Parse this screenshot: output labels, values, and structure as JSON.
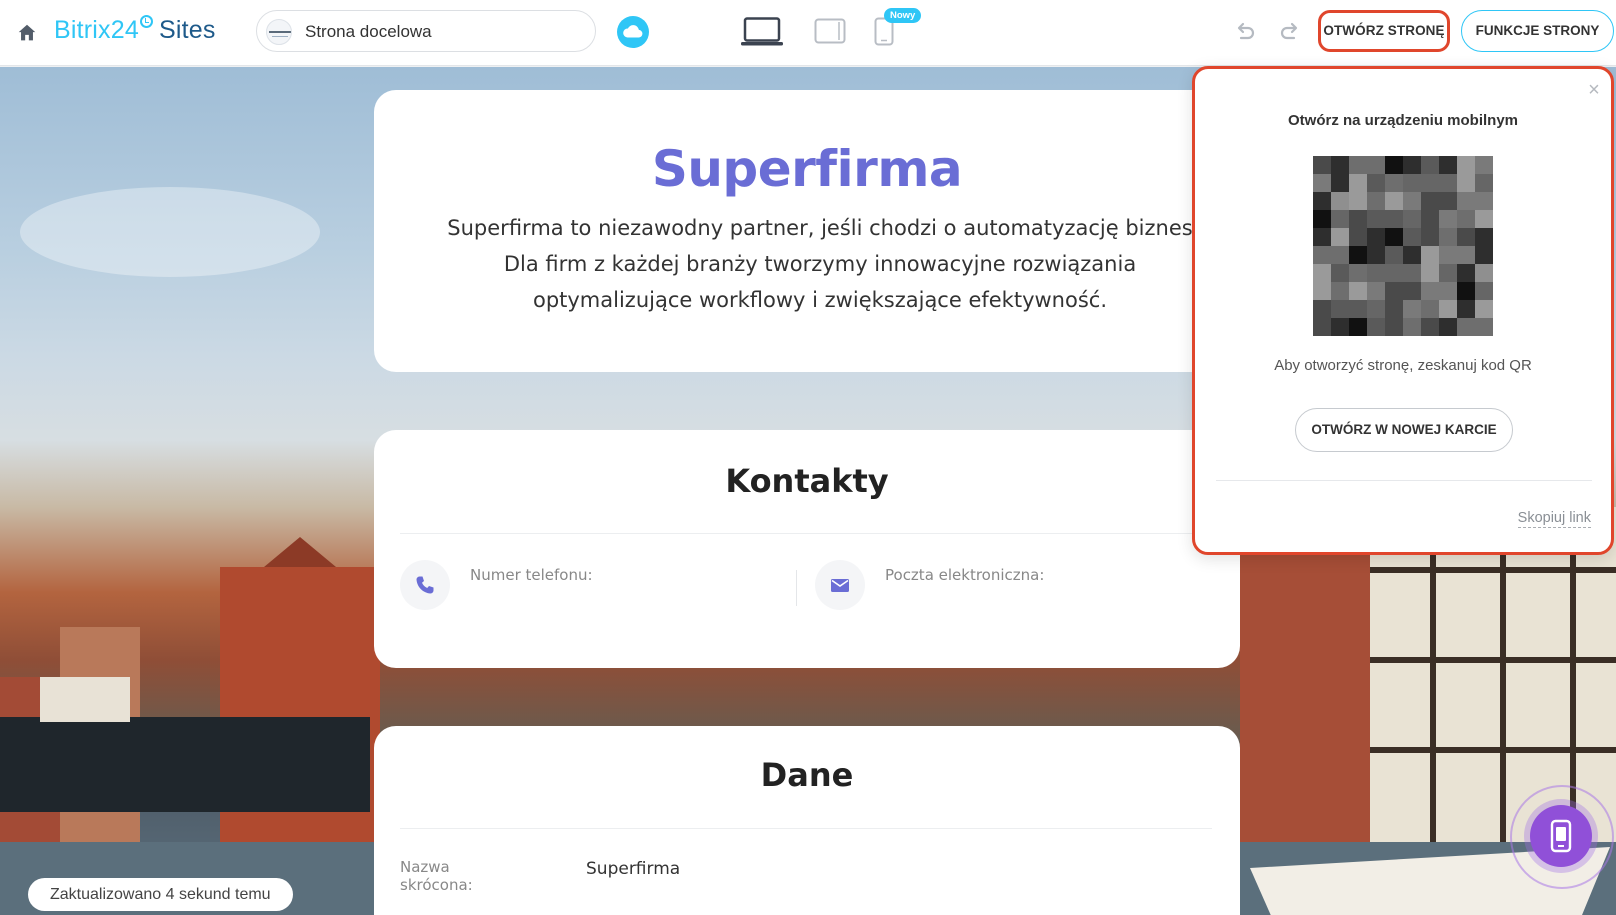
{
  "toolbar": {
    "brand_name": "Bitrix24",
    "brand_product": "Sites",
    "site_name": "Strona docelowa",
    "new_badge": "Nowy",
    "open_page_label": "OTWÓRZ STRONĘ",
    "page_features_label": "FUNKCJE STRONY",
    "accent_color": "#2fc6f6",
    "highlight_color": "#e0462c"
  },
  "hero": {
    "title": "Superfirma",
    "text": "Superfirma to niezawodny partner, jeśli chodzi o automatyzację biznes\nDla firm z każdej branży tworzymy innowacyjne rozwiązania\noptymalizujące workflowy i zwiększające efektywność.",
    "title_color": "#6a6dd5"
  },
  "contacts": {
    "title": "Kontakty",
    "phone_label": "Numer telefonu:",
    "email_label": "Poczta elektroniczna:"
  },
  "dane": {
    "title": "Dane",
    "short_name_label": "Nazwa skrócona:",
    "short_name_value": "Superfirma"
  },
  "status": {
    "updated": "Zaktualizowano 4 sekund temu"
  },
  "popup": {
    "title": "Otwórz na urządzeniu mobilnym",
    "hint": "Aby otworzyć stronę, zeskanuj kod QR",
    "open_new_tab_label": "OTWÓRZ W NOWEJ KARCIE",
    "copy_link_label": "Skopiuj link",
    "close_icon": "×"
  },
  "icons": {
    "home": "home-icon",
    "cloud": "cloud-icon",
    "laptop": "laptop-icon",
    "tablet": "tablet-icon",
    "phone": "phone-icon",
    "undo": "undo-icon",
    "redo": "redo-icon",
    "contact_phone": "phone-icon",
    "contact_mail": "envelope-icon",
    "fab": "mobile-preview-icon"
  }
}
